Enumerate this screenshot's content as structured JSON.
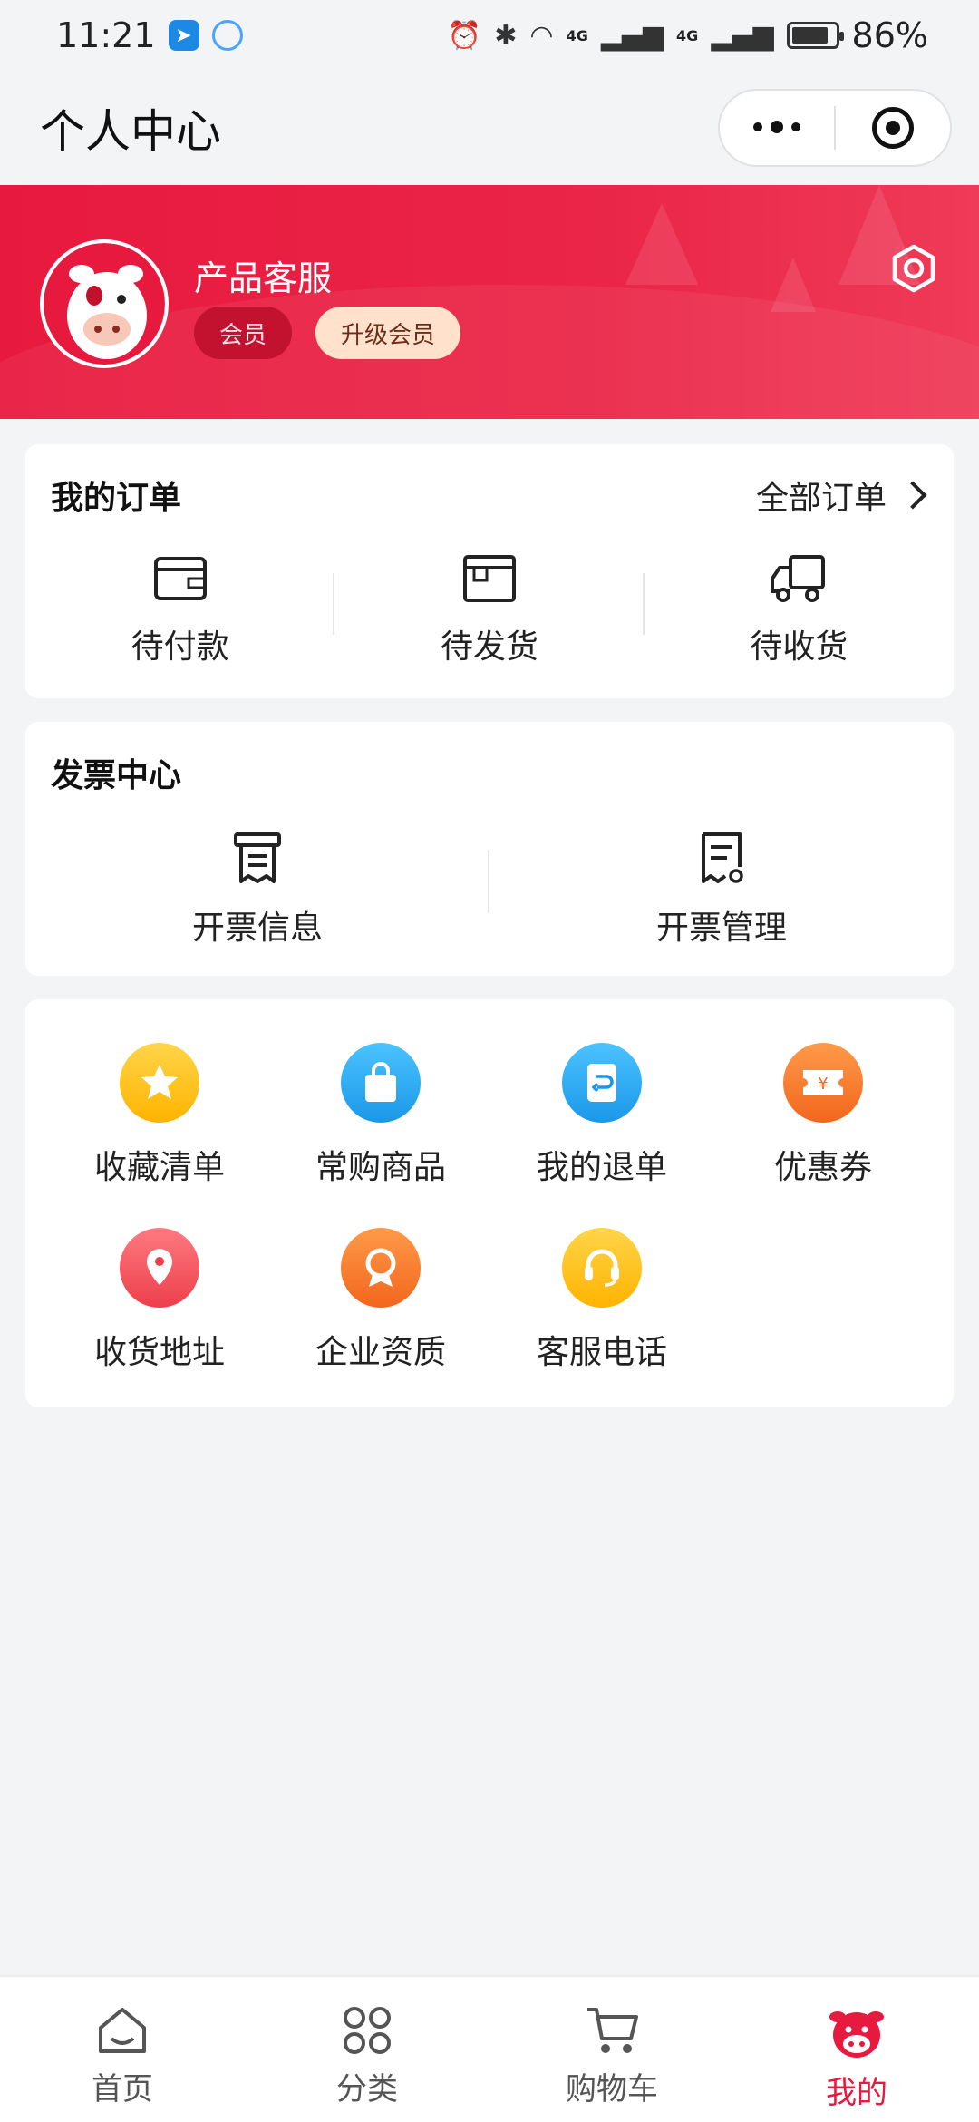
{
  "status_bar": {
    "time": "11:21",
    "battery": "86%",
    "battery_level": 0.86,
    "net1": "4G",
    "net2": "4G"
  },
  "header": {
    "title": "个人中心"
  },
  "profile": {
    "name": "产品客服",
    "member_badge": "会员",
    "upgrade_badge": "升级会员"
  },
  "orders": {
    "title": "我的订单",
    "all_label": "全部订单",
    "items": [
      {
        "label": "待付款",
        "icon": "wallet-icon"
      },
      {
        "label": "待发货",
        "icon": "box-icon"
      },
      {
        "label": "待收货",
        "icon": "truck-icon"
      }
    ]
  },
  "invoice": {
    "title": "发票中心",
    "items": [
      {
        "label": "开票信息",
        "icon": "receipt-icon"
      },
      {
        "label": "开票管理",
        "icon": "receipt-settings-icon"
      }
    ]
  },
  "services": {
    "items": [
      {
        "label": "收藏清单",
        "icon": "star-icon",
        "color": "#ffc21a"
      },
      {
        "label": "常购商品",
        "icon": "shopping-bag-icon",
        "color": "#2aa8f0"
      },
      {
        "label": "我的退单",
        "icon": "return-icon",
        "color": "#2aa8f0"
      },
      {
        "label": "优惠券",
        "icon": "coupon-icon",
        "color": "#fb7a2e"
      },
      {
        "label": "收货地址",
        "icon": "location-pin-icon",
        "color": "#f0545f"
      },
      {
        "label": "企业资质",
        "icon": "certificate-icon",
        "color": "#fb7a2e"
      },
      {
        "label": "客服电话",
        "icon": "headset-icon",
        "color": "#ffc21a"
      }
    ]
  },
  "tabbar": {
    "items": [
      {
        "label": "首页",
        "icon": "home-icon"
      },
      {
        "label": "分类",
        "icon": "category-icon"
      },
      {
        "label": "购物车",
        "icon": "cart-icon"
      },
      {
        "label": "我的",
        "icon": "mascot-icon",
        "active": true
      }
    ]
  },
  "colors": {
    "brand_red": "#e8193e",
    "background": "#f3f4f6"
  }
}
